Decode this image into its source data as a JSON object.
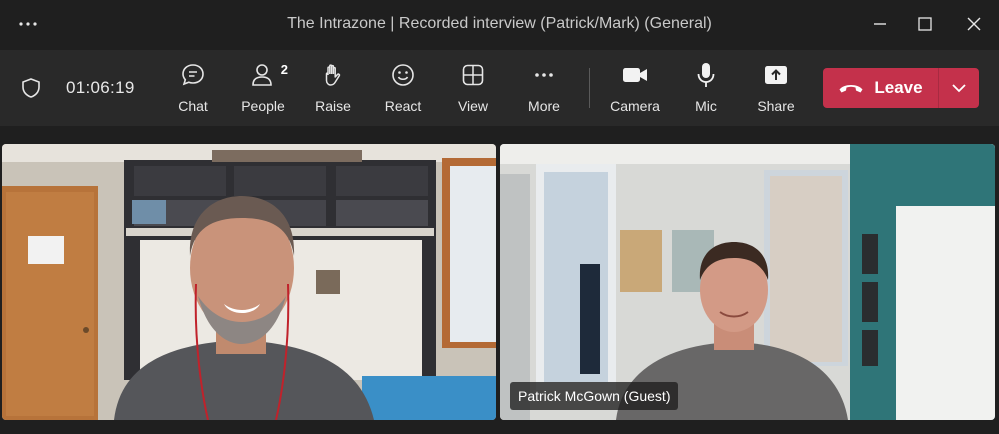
{
  "window": {
    "title": "The Intrazone | Recorded interview (Patrick/Mark) (General)",
    "more_icon": "ellipsis-icon",
    "controls": [
      "minimize-icon",
      "maximize-icon",
      "close-icon"
    ]
  },
  "toolbar": {
    "timer": "01:06:19",
    "buttons": {
      "chat": "Chat",
      "people": "People",
      "people_count": "2",
      "raise": "Raise",
      "react": "React",
      "view": "View",
      "more": "More",
      "camera": "Camera",
      "mic": "Mic",
      "share": "Share"
    },
    "leave": {
      "label": "Leave",
      "color": "#c4314b"
    }
  },
  "participants": [
    {
      "name": ""
    },
    {
      "name": "Patrick McGown (Guest)"
    }
  ]
}
